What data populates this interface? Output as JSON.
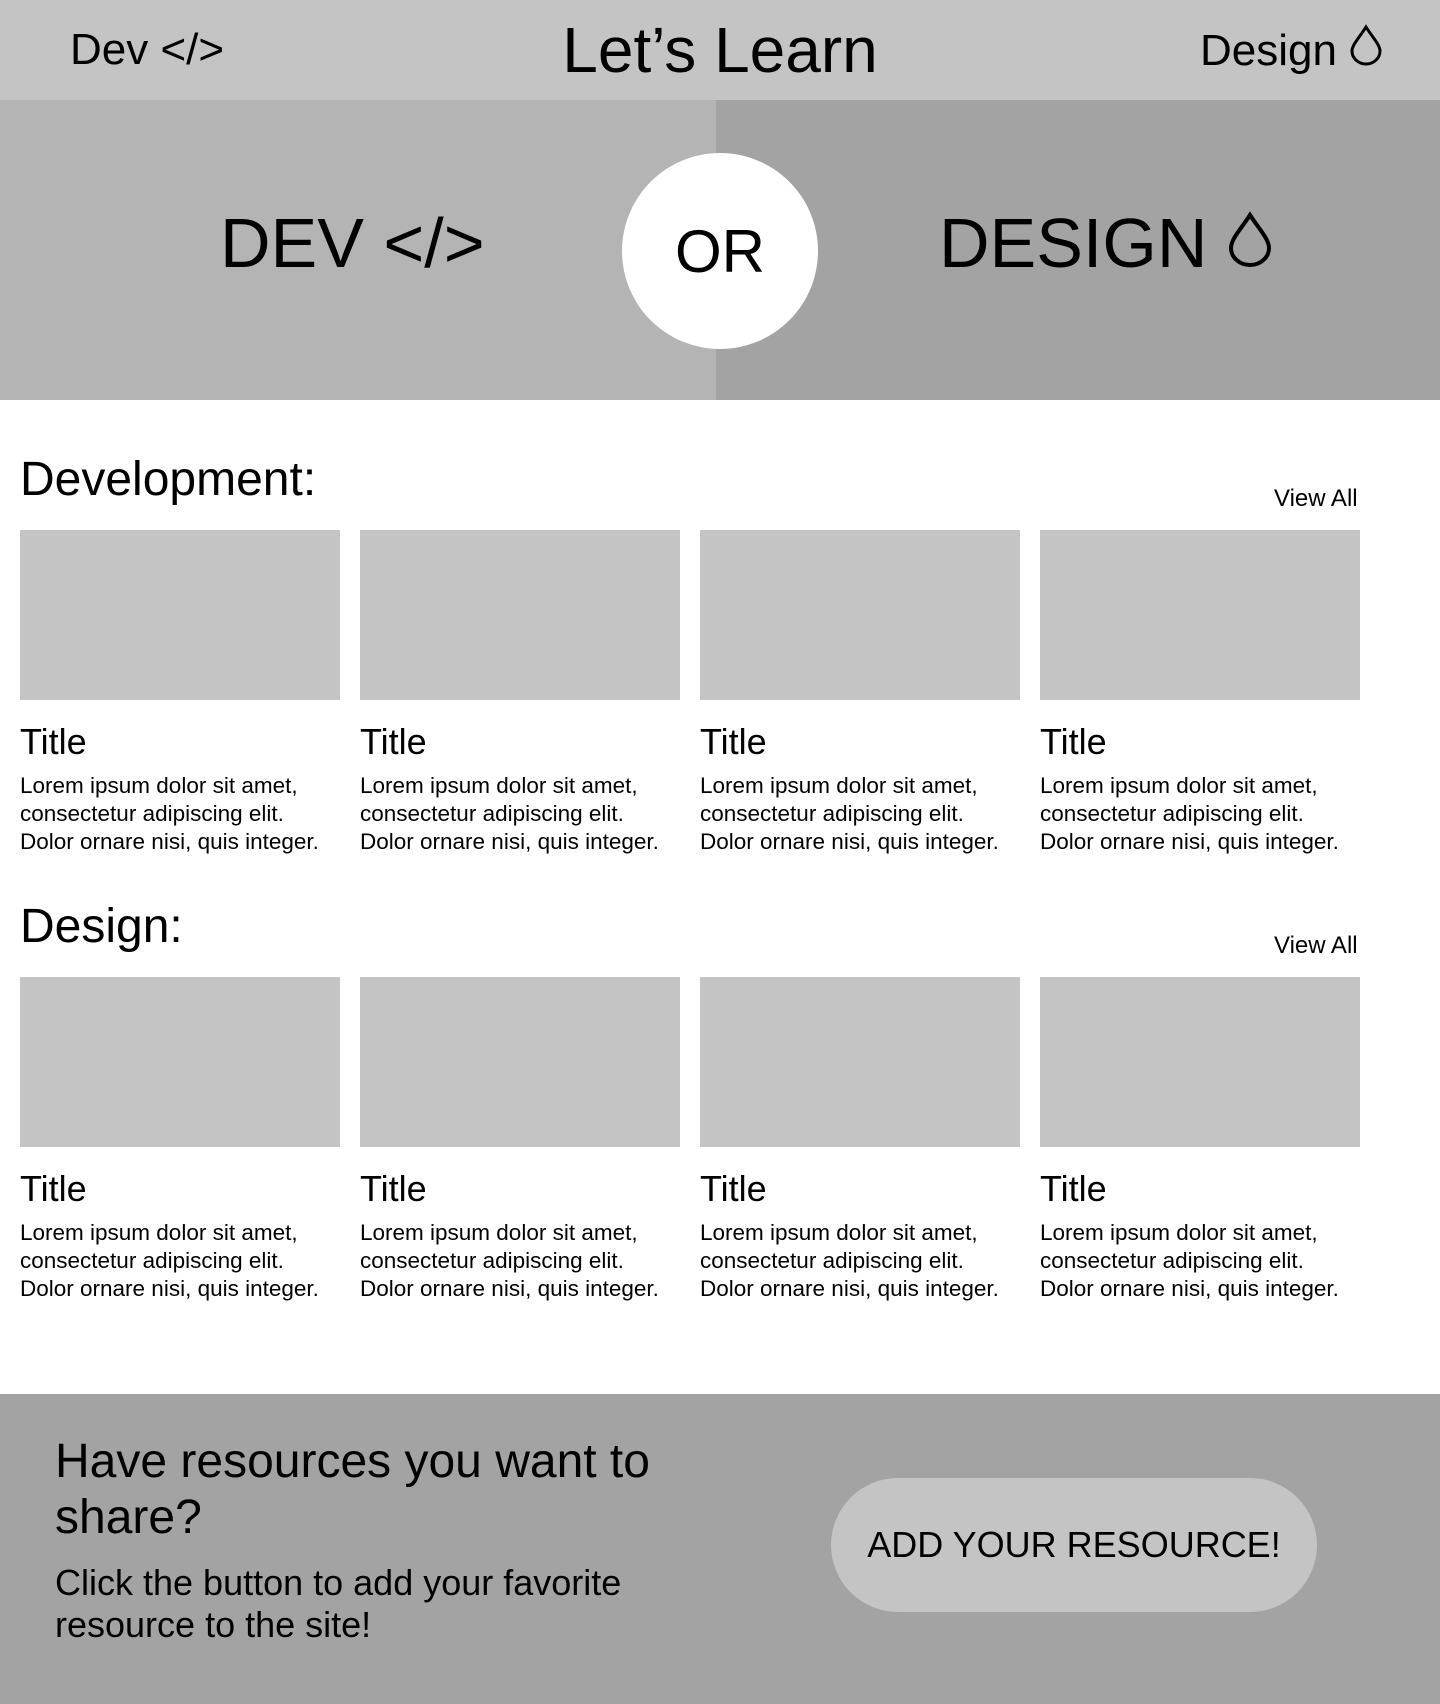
{
  "header": {
    "nav_dev": "Dev </>",
    "title": "Let’s Learn",
    "nav_design": "Design",
    "nav_design_icon": "drop-icon"
  },
  "hero": {
    "dev_label": "DEV </>",
    "or_label": "OR",
    "design_label": "DESIGN",
    "design_icon": "drop-icon",
    "dev_panel_color": "#b4b4b4",
    "design_panel_color": "#a3a3a3"
  },
  "development": {
    "heading": "Development:",
    "view_all": "View All",
    "cards": [
      {
        "title": "Title",
        "line1": "Lorem ipsum dolor sit amet,",
        "line2": "consectetur adipiscing elit.",
        "line3": "Dolor ornare nisi, quis integer."
      },
      {
        "title": "Title",
        "line1": "Lorem ipsum dolor sit amet,",
        "line2": "consectetur adipiscing elit.",
        "line3": "Dolor ornare nisi, quis integer."
      },
      {
        "title": "Title",
        "line1": "Lorem ipsum dolor sit amet,",
        "line2": "consectetur adipiscing elit.",
        "line3": "Dolor ornare nisi, quis integer."
      },
      {
        "title": "Title",
        "line1": "Lorem ipsum dolor sit amet,",
        "line2": "consectetur adipiscing elit.",
        "line3": "Dolor ornare nisi, quis integer."
      }
    ]
  },
  "design": {
    "heading": "Design:",
    "view_all": "View All",
    "cards": [
      {
        "title": "Title",
        "line1": "Lorem ipsum dolor sit amet,",
        "line2": "consectetur adipiscing elit.",
        "line3": "Dolor ornare nisi, quis integer."
      },
      {
        "title": "Title",
        "line1": "Lorem ipsum dolor sit amet,",
        "line2": "consectetur adipiscing elit.",
        "line3": "Dolor ornare nisi, quis integer."
      },
      {
        "title": "Title",
        "line1": "Lorem ipsum dolor sit amet,",
        "line2": "consectetur adipiscing elit.",
        "line3": "Dolor ornare nisi, quis integer."
      },
      {
        "title": "Title",
        "line1": "Lorem ipsum dolor sit amet,",
        "line2": "consectetur adipiscing elit.",
        "line3": "Dolor ornare nisi, quis integer."
      }
    ]
  },
  "footer": {
    "heading": "Have resources you want to share?",
    "text": "Click the button to add your favorite resource to the site!",
    "button_label": "ADD YOUR RESOURCE!",
    "background_color": "#a3a3a3",
    "button_color": "#c4c4c4"
  }
}
